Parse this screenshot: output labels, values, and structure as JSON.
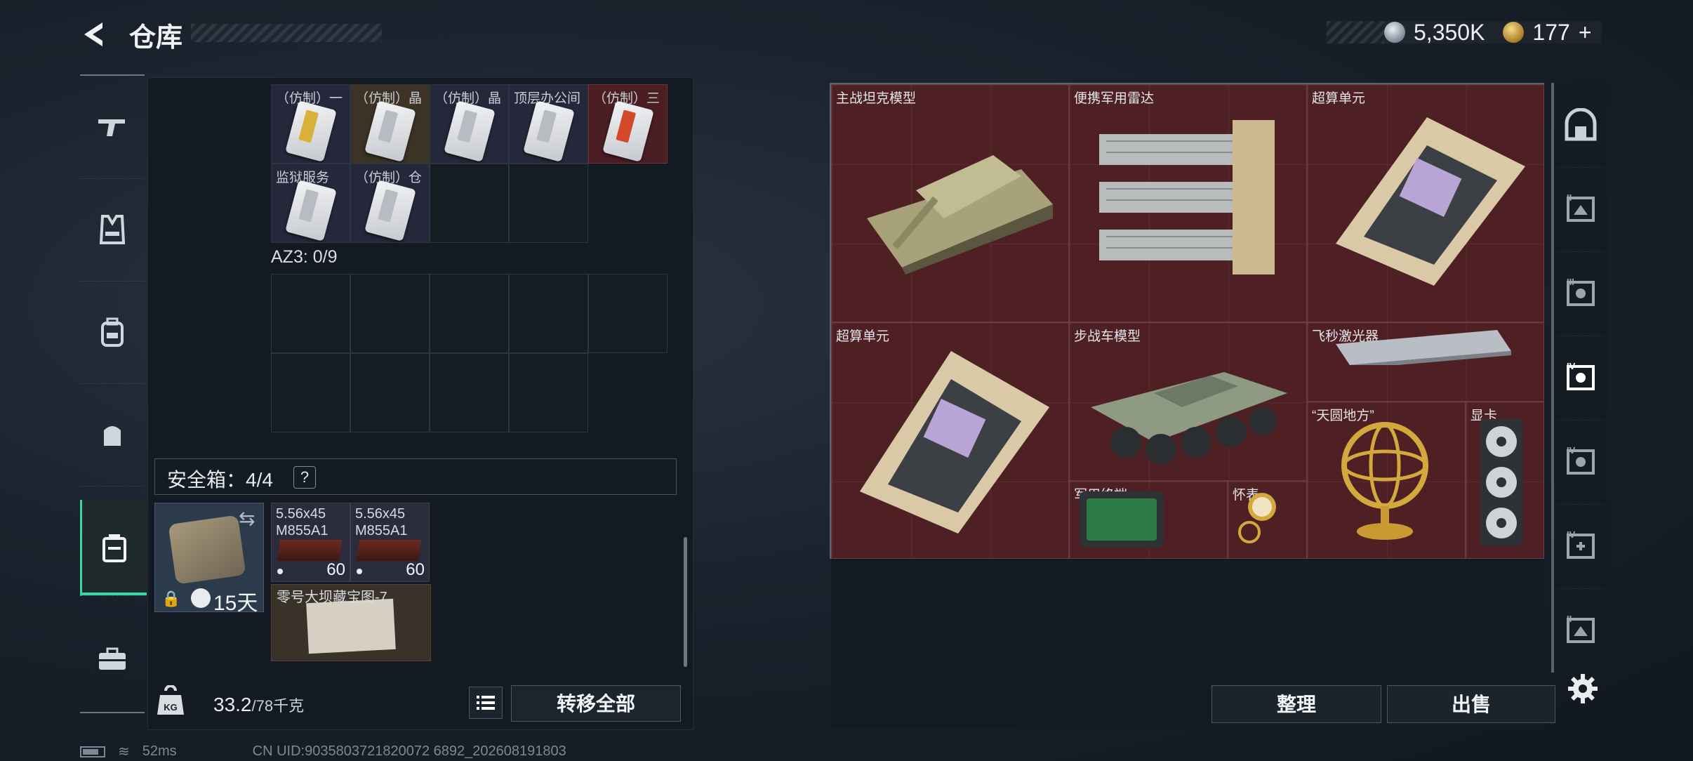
{
  "header": {
    "title": "仓库",
    "currency_silver": "5,350K",
    "currency_gold": "177",
    "add_label": "+"
  },
  "left_nav": {
    "items": [
      "weapon-icon",
      "vest-icon",
      "backpack-icon",
      "pouch-icon",
      "safe-container-icon",
      "toolbox-icon"
    ],
    "active": "safe-container-icon"
  },
  "container_grid": {
    "items": [
      {
        "label": "（仿制）一",
        "variant": "gold"
      },
      {
        "label": "（仿制）晶",
        "variant": "brown"
      },
      {
        "label": "（仿制）晶",
        "variant": "plain"
      },
      {
        "label": "顶层办公间",
        "variant": "plain"
      },
      {
        "label": "（仿制）三",
        "variant": "red"
      },
      {
        "label": "监狱服务",
        "variant": "plain"
      },
      {
        "label": "（仿制）仓",
        "variant": "plain"
      }
    ]
  },
  "az3": {
    "label": "AZ3: 0/9"
  },
  "safe_box": {
    "label": "安全箱：4/4",
    "help": "?",
    "duration": "15天",
    "ammo": [
      {
        "line1": "5.56x45",
        "line2": "M855A1",
        "count": "60"
      },
      {
        "line1": "5.56x45",
        "line2": "M855A1",
        "count": "60"
      }
    ],
    "map_label": "零号大坝藏宝图-7"
  },
  "footer_left": {
    "weight_current": "33.2",
    "weight_max": "/78千克",
    "transfer_all": "转移全部"
  },
  "status_bar": {
    "ping": "52ms",
    "uid": "CN UID:9035803721820072 6892_202608191803"
  },
  "stash": {
    "items": [
      {
        "id": "tank",
        "label": "主战坦克模型"
      },
      {
        "id": "radar",
        "label": "便携军用雷达"
      },
      {
        "id": "super1",
        "label": "超算单元"
      },
      {
        "id": "super2",
        "label": "超算单元"
      },
      {
        "id": "ifv",
        "label": "步战车模型"
      },
      {
        "id": "laser",
        "label": "飞秒激光器"
      },
      {
        "id": "globe",
        "label": "“天圆地方”"
      },
      {
        "id": "gpu",
        "label": "显卡"
      },
      {
        "id": "terminal",
        "label": "军用终端"
      },
      {
        "id": "watch",
        "label": "怀表"
      }
    ]
  },
  "right_nav": {
    "items": [
      {
        "icon": "vault-icon",
        "roman": ""
      },
      {
        "icon": "stash-tab-icon",
        "roman": "II"
      },
      {
        "icon": "stash-tab-icon",
        "roman": "III"
      },
      {
        "icon": "stash-tab-icon",
        "roman": "IV"
      },
      {
        "icon": "stash-tab-icon",
        "roman": "IV"
      },
      {
        "icon": "stash-tab-add-icon",
        "roman": "IV"
      },
      {
        "icon": "stash-tab-icon",
        "roman": "II"
      }
    ],
    "active_index": 3
  },
  "footer_right": {
    "sort": "整理",
    "sell": "出售"
  },
  "colors": {
    "accent": "#3bd6a6",
    "stash_bg": "#4e2024",
    "panel": "#131a22"
  }
}
